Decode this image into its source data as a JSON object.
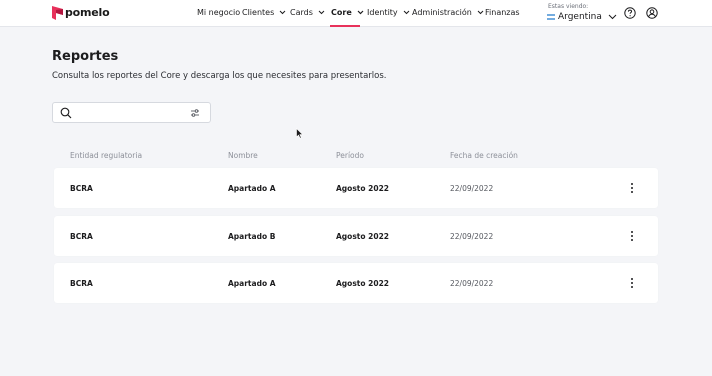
{
  "brand": {
    "name": "pomelo",
    "accent": "#e8315b"
  },
  "nav": {
    "items": [
      {
        "label": "Mi negocio",
        "dropdown": false
      },
      {
        "label": "Clientes",
        "dropdown": true
      },
      {
        "label": "Cards",
        "dropdown": true
      },
      {
        "label": "Core",
        "dropdown": true,
        "active": true
      },
      {
        "label": "Identity",
        "dropdown": true
      },
      {
        "label": "Administración",
        "dropdown": true
      },
      {
        "label": "Finanzas",
        "dropdown": false
      }
    ]
  },
  "country": {
    "caption": "Estas viendo:",
    "value": "Argentina",
    "flag": "argentina-flag-icon"
  },
  "header_icons": [
    "help-icon",
    "user-icon"
  ],
  "page": {
    "title": "Reportes",
    "subtitle": "Consulta los reportes del Core y descarga los que necesites para presentarlos."
  },
  "search": {
    "placeholder": "",
    "value": ""
  },
  "table": {
    "columns": [
      "Entidad regulatoria",
      "Nombre",
      "Período",
      "Fecha de creación"
    ],
    "rows": [
      {
        "entity": "BCRA",
        "name": "Apartado A",
        "period": "Agosto 2022",
        "date": "22/09/2022"
      },
      {
        "entity": "BCRA",
        "name": "Apartado B",
        "period": "Agosto 2022",
        "date": "22/09/2022"
      },
      {
        "entity": "BCRA",
        "name": "Apartado A",
        "period": "Agosto 2022",
        "date": "22/09/2022"
      }
    ]
  }
}
